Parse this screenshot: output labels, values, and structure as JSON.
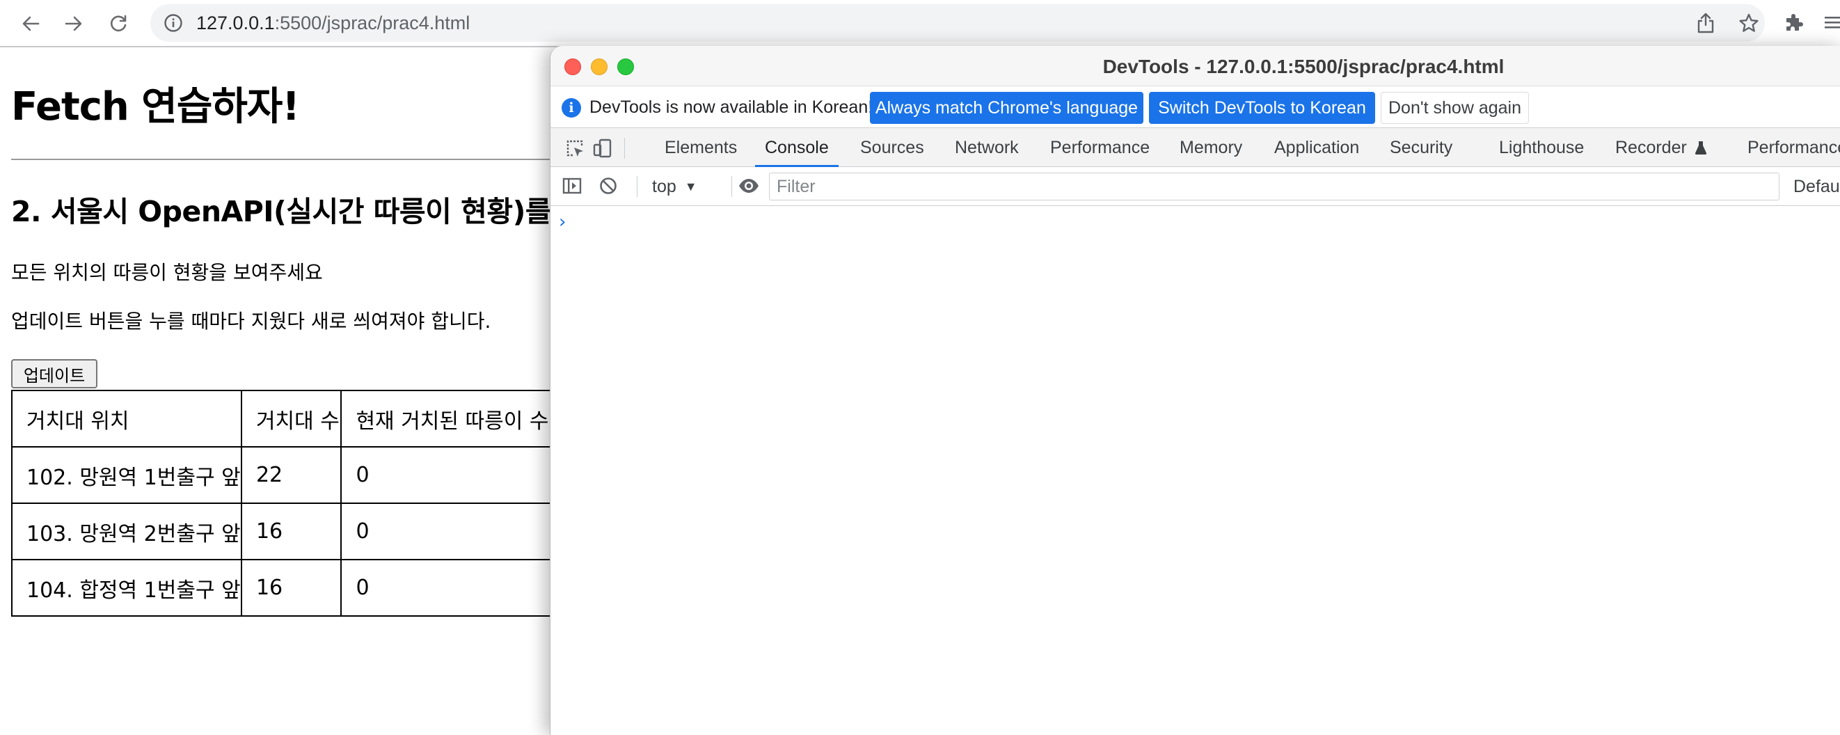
{
  "browser": {
    "url_host": "127.0.0.1",
    "url_path": ":5500/jsprac/prac4.html"
  },
  "page": {
    "title": "Fetch 연습하자!",
    "subtitle": "2. 서울시 OpenAPI(실시간 따릉이 현황)를",
    "desc1": "모든 위치의 따릉이 현황을 보여주세요",
    "desc2": "업데이트 버튼을 누를 때마다 지웠다 새로 씌여져야 합니다.",
    "update_button": "업데이트",
    "table": {
      "headers": [
        "거치대 위치",
        "거치대 수",
        "현재 거치된 따릉이 수"
      ],
      "rows": [
        [
          "102. 망원역 1번출구 앞",
          "22",
          "0"
        ],
        [
          "103. 망원역 2번출구 앞",
          "16",
          "0"
        ],
        [
          "104. 합정역 1번출구 앞",
          "16",
          "0"
        ]
      ]
    }
  },
  "devtools": {
    "window_title": "DevTools - 127.0.0.1:5500/jsprac/prac4.html",
    "infobar": {
      "message": "DevTools is now available in Korean!",
      "match_button": "Always match Chrome's language",
      "switch_button": "Switch DevTools to Korean",
      "dismiss_button": "Don't show again"
    },
    "tabs": [
      "Elements",
      "Console",
      "Sources",
      "Network",
      "Performance",
      "Memory",
      "Application",
      "Security",
      "Lighthouse",
      "Recorder",
      "Performance"
    ],
    "active_tab": "Console",
    "console": {
      "context": "top",
      "filter_placeholder": "Filter",
      "levels": "Default",
      "prompt": "›"
    },
    "accent_color": "#1a73e8"
  },
  "icons": [
    "back-arrow-icon",
    "forward-arrow-icon",
    "reload-icon",
    "site-info-icon",
    "share-icon",
    "bookmark-star-icon",
    "extensions-puzzle-icon",
    "menu-icon",
    "inspect-element-icon",
    "device-toolbar-icon",
    "console-sidebar-icon",
    "clear-console-icon",
    "live-expression-eye-icon",
    "recorder-flask-icon"
  ]
}
